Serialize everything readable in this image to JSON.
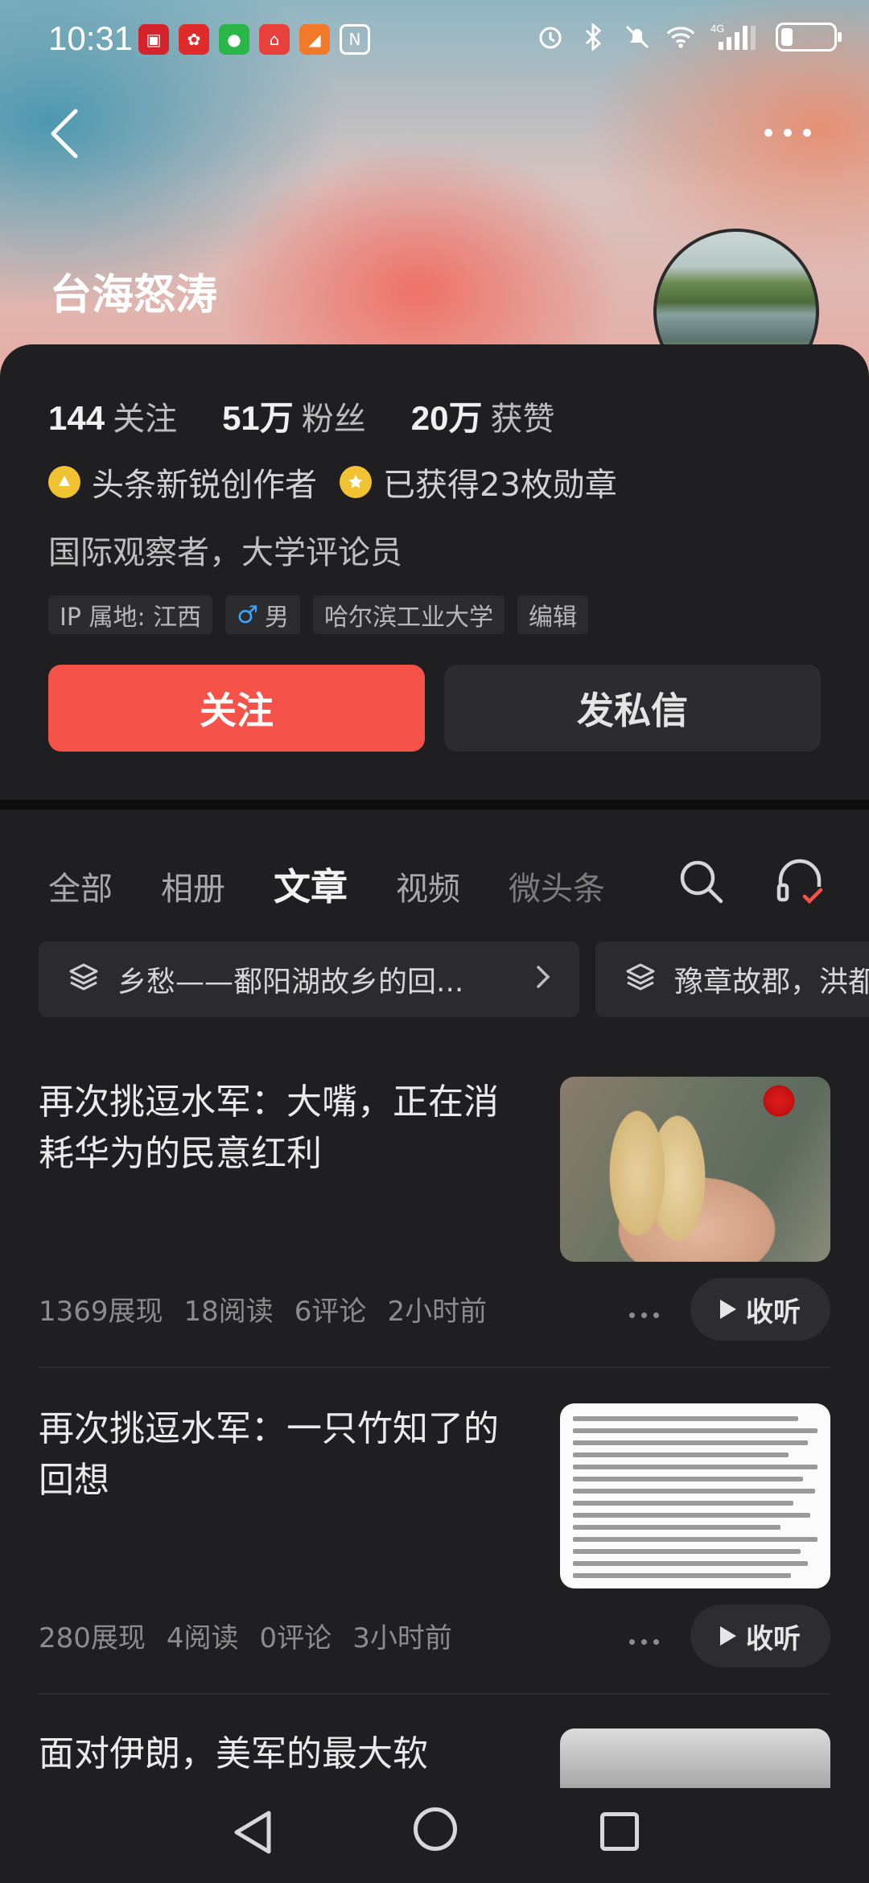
{
  "status_bar": {
    "time": "10:31",
    "network": "4G",
    "icons": [
      "alarm-icon",
      "bluetooth-icon",
      "mute-icon",
      "wifi-icon",
      "signal-icon",
      "battery-icon"
    ]
  },
  "profile": {
    "name": "台海怒涛",
    "stats": [
      {
        "num": "144",
        "label": "关注"
      },
      {
        "num": "51万",
        "label": "粉丝"
      },
      {
        "num": "20万",
        "label": "获赞"
      }
    ],
    "badges": [
      {
        "text": "头条新锐创作者"
      },
      {
        "text": "已获得23枚勋章"
      }
    ],
    "bio": "国际观察者，大学评论员",
    "tags": {
      "ip": "IP 属地: 江西",
      "gender": "男",
      "school": "哈尔滨工业大学",
      "role": "编辑"
    },
    "follow_label": "关注",
    "message_label": "发私信"
  },
  "tabs": [
    "全部",
    "相册",
    "文章",
    "视频",
    "微头条"
  ],
  "active_tab": "文章",
  "collections": [
    {
      "label": "乡愁——鄱阳湖故乡的回..."
    },
    {
      "label": "豫章故郡，洪都"
    }
  ],
  "articles": [
    {
      "title": "再次挑逗水军：大嘴，正在消耗华为的民意红利",
      "views": "1369展现",
      "reads": "18阅读",
      "comments": "6评论",
      "time": "2小时前",
      "listen_label": "收听"
    },
    {
      "title": "再次挑逗水军：一只竹知了的回想",
      "views": "280展现",
      "reads": "4阅读",
      "comments": "0评论",
      "time": "3小时前",
      "listen_label": "收听"
    },
    {
      "title": "面对伊朗，美军的最大软"
    }
  ],
  "colors": {
    "accent": "#f5534a",
    "background": "#1f1f21",
    "card": "#2c2c2e",
    "badge": "#f1c232"
  }
}
